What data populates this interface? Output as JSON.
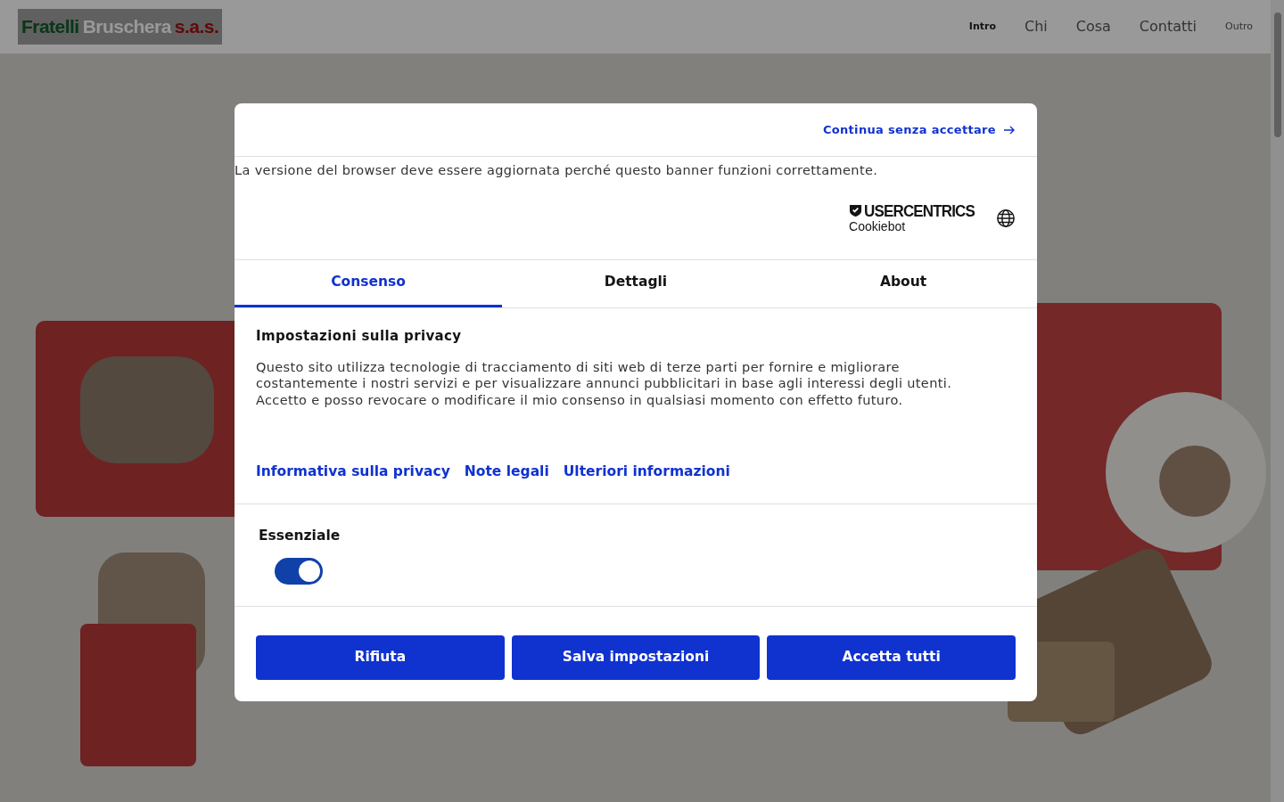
{
  "header": {
    "logo": [
      {
        "text": "Fratelli",
        "kind": "green"
      },
      {
        "text": "Bruschera",
        "kind": "light"
      },
      {
        "text": "s.a.s.",
        "kind": "red"
      }
    ],
    "nav": [
      {
        "label": "Intro",
        "selected": true,
        "kind": "small"
      },
      {
        "label": "Chi",
        "selected": false,
        "kind": "large"
      },
      {
        "label": "Cosa",
        "selected": false,
        "kind": "large"
      },
      {
        "label": "Contatti",
        "selected": false,
        "kind": "large"
      },
      {
        "label": "Outro",
        "selected": false,
        "kind": "small"
      }
    ]
  },
  "dialog": {
    "continue_link": "Continua senza accettare",
    "browser_notice": "La versione del browser deve essere aggiornata perché questo banner funzioni correttamente.",
    "brand": {
      "name": "USERCENTRICS",
      "product": "Cookiebot"
    },
    "tabs": [
      {
        "label": "Consenso",
        "selected": true
      },
      {
        "label": "Dettagli",
        "selected": false
      },
      {
        "label": "About",
        "selected": false
      }
    ],
    "heading": "Impostazioni sulla privacy",
    "body": "Questo sito utilizza tecnologie di tracciamento di siti web di terze parti per fornire e migliorare costantemente i nostri servizi e per visualizzare annunci pubblicitari in base agli interessi degli utenti. Accetto e posso revocare o modificare il mio consenso in qualsiasi momento con effetto futuro.",
    "links": [
      "Informativa sulla privacy",
      "Note legali",
      "Ulteriori informazioni"
    ],
    "categories": [
      {
        "label": "Essenziale",
        "on": true
      }
    ],
    "buttons": [
      "Rifiuta",
      "Salva impostazioni",
      "Accetta tutti"
    ]
  }
}
